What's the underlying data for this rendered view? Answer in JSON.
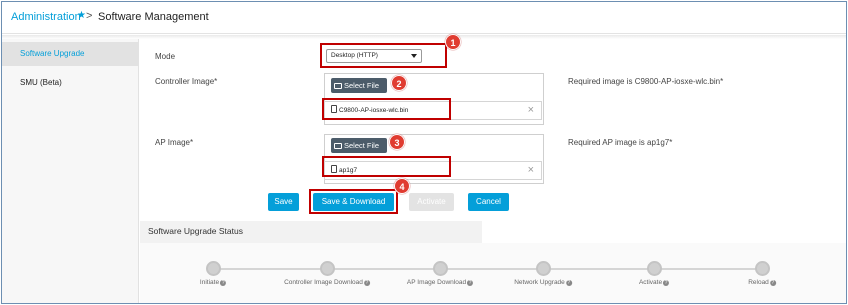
{
  "breadcrumb": {
    "parent": "Administration",
    "separator": ">",
    "current": "Software Management"
  },
  "sidebar": {
    "items": [
      {
        "label": "Software Upgrade",
        "active": true
      },
      {
        "label": "SMU (Beta)",
        "active": false
      }
    ]
  },
  "form": {
    "mode": {
      "label": "Mode",
      "selected": "Desktop (HTTP)"
    },
    "controller_image": {
      "label": "Controller Image*",
      "button": "Select File",
      "file": "C9800-AP-iosxe-wlc.bin",
      "requirement": "Required image is C9800-AP-iosxe-wlc.bin*"
    },
    "ap_image": {
      "label": "AP Image*",
      "button": "Select File",
      "file": "ap1g7",
      "requirement": "Required AP image is ap1g7*"
    }
  },
  "actions": {
    "save": "Save",
    "save_download": "Save & Download",
    "activate": "Activate",
    "cancel": "Cancel"
  },
  "callouts": [
    "1",
    "2",
    "3",
    "4"
  ],
  "status": {
    "title": "Software Upgrade Status",
    "steps": [
      "Initiate",
      "Controller Image Download",
      "AP Image Download",
      "Network Upgrade",
      "Activate",
      "Reload"
    ]
  },
  "colors": {
    "accent": "#049fd9",
    "callout": "#e03c31",
    "highlight": "#c00000"
  }
}
